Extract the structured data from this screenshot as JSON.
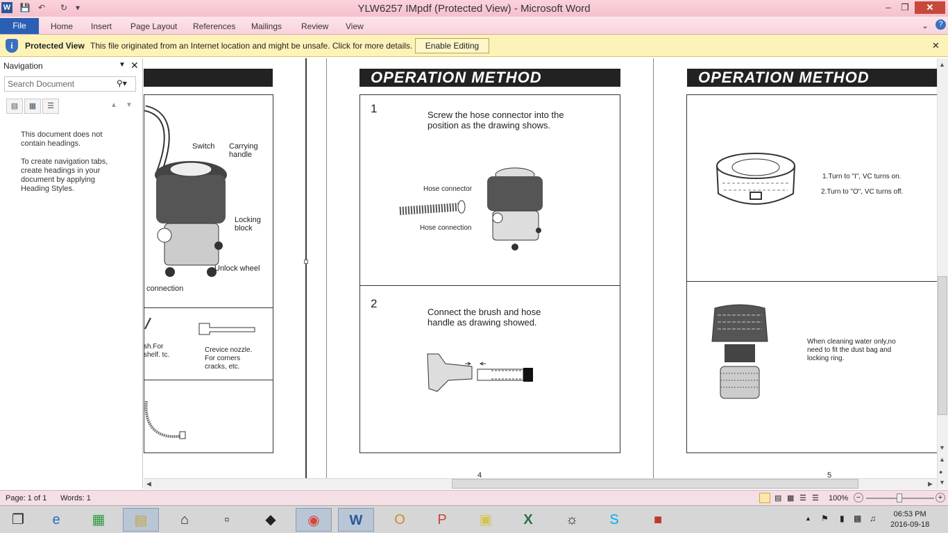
{
  "window": {
    "title": "YLW6257 IMpdf (Protected View) - Microsoft Word",
    "app_icon": "W"
  },
  "ribbon": {
    "file_tab": "File",
    "tabs": [
      "Home",
      "Insert",
      "Page Layout",
      "References",
      "Mailings",
      "Review",
      "View"
    ]
  },
  "protected_view": {
    "title": "Protected View",
    "message": "This file originated from an Internet location and might be unsafe. Click for more details.",
    "enable_button": "Enable Editing"
  },
  "navigation": {
    "title": "Navigation",
    "search_placeholder": "Search Document",
    "msg1": "This document does not contain headings.",
    "msg2": "To create navigation tabs, create headings in your document by applying Heading Styles."
  },
  "document": {
    "page3": {
      "labels": {
        "switch": "Switch",
        "carrying_handle": "Carrying handle",
        "locking_block": "Locking block",
        "unlock_wheel": "Unlock wheel",
        "connection": "connection",
        "brush_partial": "sh.For shelf. tc.",
        "crevice": "Crevice nozzle. For corners cracks, etc."
      }
    },
    "page4": {
      "header": "OPERATION METHOD",
      "step1_num": "1",
      "step1_text": "Screw the hose connector into the position as the drawing shows.",
      "hose_connector": "Hose connector",
      "hose_connection": "Hose connection",
      "step2_num": "2",
      "step2_text": "Connect the brush and hose handle as drawing showed.",
      "page_number": "4"
    },
    "page5": {
      "header": "OPERATION METHOD",
      "turn_on": "1.Turn to \"I\", VC turns on.",
      "turn_off": "2.Turn to \"O\", VC turns off.",
      "water_note": "When cleaning water only,no need to fit the dust bag and locking ring.",
      "page_number": "5"
    }
  },
  "status": {
    "page": "Page: 1 of 1",
    "words": "Words: 1",
    "zoom": "100%"
  },
  "taskbar": {
    "time": "06:53 PM",
    "date": "2016-09-18"
  }
}
